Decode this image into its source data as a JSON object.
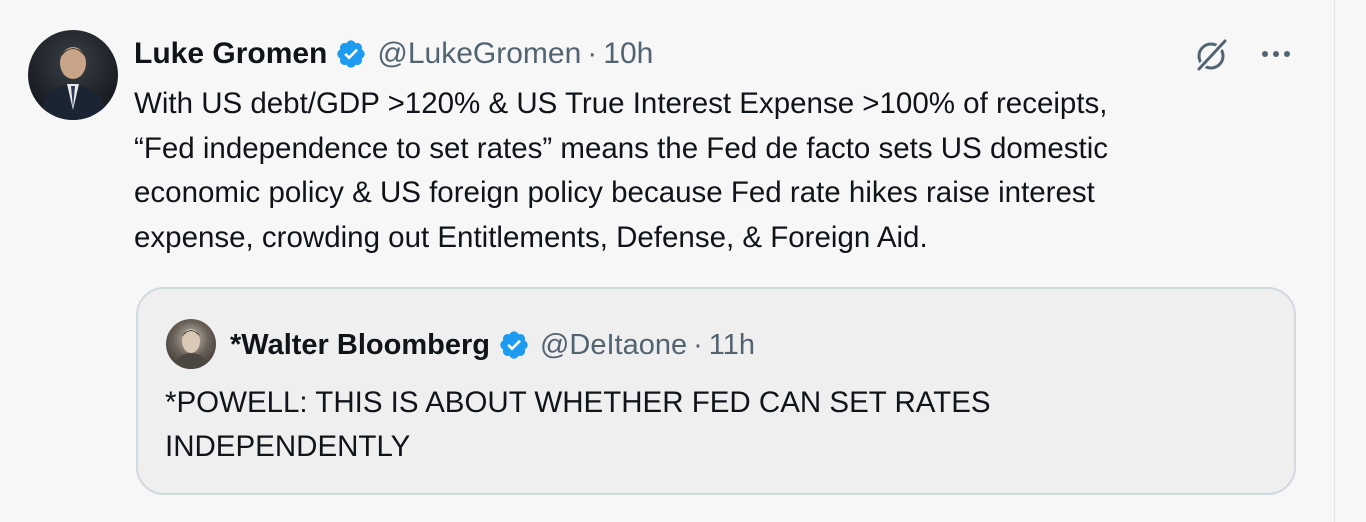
{
  "tweet": {
    "author_name": "Luke Gromen",
    "author_handle": "@LukeGromen",
    "separator": "·",
    "time": "10h",
    "text": "With US debt/GDP >120%  & US True Interest Expense >100% of receipts,\n“Fed independence to set rates” means the Fed de facto sets US domestic\neconomic policy & US foreign policy because Fed rate hikes raise interest\nexpense, crowding out Entitlements, Defense, & Foreign Aid."
  },
  "quoted_tweet": {
    "author_name": "*Walter Bloomberg",
    "author_handle": "@DeItaone",
    "separator": "·",
    "time": "11h",
    "text": "*POWELL: THIS IS ABOUT WHETHER FED CAN SET RATES\nINDEPENDENTLY"
  },
  "icons": {
    "verified": "verified-badge-icon",
    "grok": "grok-icon",
    "more": "more-dots-icon"
  },
  "colors": {
    "verified_blue": "#1d9bf0",
    "secondary_text": "#536471",
    "primary_text": "#0f1419"
  }
}
